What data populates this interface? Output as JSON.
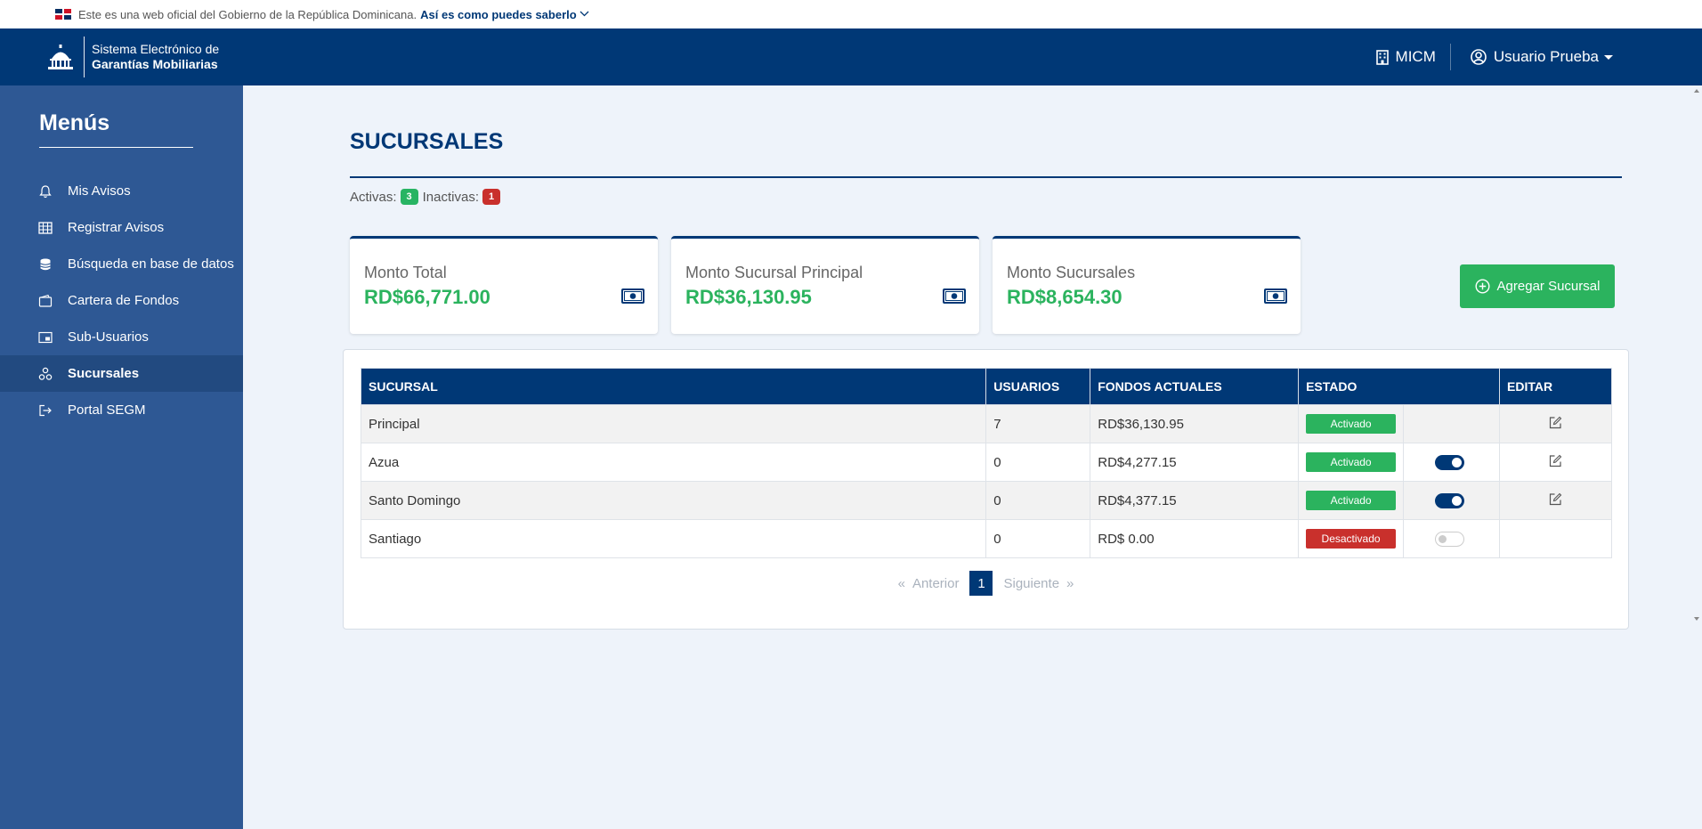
{
  "gov_banner": {
    "text": "Este es una web oficial del Gobierno de la República Dominicana.",
    "link": "Así es como puedes saberlo"
  },
  "header": {
    "brand_line1": "Sistema Electrónico de",
    "brand_line2": "Garantías Mobiliarias",
    "org": "MICM",
    "user": "Usuario Prueba"
  },
  "sidebar": {
    "title": "Menús",
    "items": [
      {
        "label": "Mis Avisos",
        "icon": "bell-icon"
      },
      {
        "label": "Registrar Avisos",
        "icon": "table-grid-icon"
      },
      {
        "label": "Búsqueda en base de datos",
        "icon": "database-icon"
      },
      {
        "label": "Cartera de Fondos",
        "icon": "wallet-icon"
      },
      {
        "label": "Sub-Usuarios",
        "icon": "user-card-icon"
      },
      {
        "label": "Sucursales",
        "icon": "branches-icon",
        "active": true
      },
      {
        "label": "Portal SEGM",
        "icon": "sign-out-icon"
      }
    ]
  },
  "page": {
    "title": "SUCURSALES",
    "active_label": "Activas:",
    "active_count": "3",
    "inactive_label": "Inactivas:",
    "inactive_count": "1"
  },
  "cards": [
    {
      "label": "Monto Total",
      "value": "RD$66,771.00",
      "icon": "money-bill-icon"
    },
    {
      "label": "Monto Sucursal Principal",
      "value": "RD$36,130.95",
      "icon": "money-bill-icon"
    },
    {
      "label": "Monto Sucursales",
      "value": "RD$8,654.30",
      "icon": "money-bill-icon"
    }
  ],
  "add_button": "Agregar Sucursal",
  "table": {
    "headers": [
      "SUCURSAL",
      "USUARIOS",
      "FONDOS ACTUALES",
      "ESTADO",
      "EDITAR"
    ],
    "rows": [
      {
        "name": "Principal",
        "users": "7",
        "funds": "RD$36,130.95",
        "status": "Activado",
        "active": true,
        "toggle": null,
        "editable": true
      },
      {
        "name": "Azua",
        "users": "0",
        "funds": "RD$4,277.15",
        "status": "Activado",
        "active": true,
        "toggle": true,
        "editable": true
      },
      {
        "name": "Santo Domingo",
        "users": "0",
        "funds": "RD$4,377.15",
        "status": "Activado",
        "active": true,
        "toggle": true,
        "editable": true
      },
      {
        "name": "Santiago",
        "users": "0",
        "funds": "RD$ 0.00",
        "status": "Desactivado",
        "active": false,
        "toggle": false,
        "editable": false
      }
    ]
  },
  "pagination": {
    "prev_symbol": "«",
    "prev": "Anterior",
    "current": "1",
    "next": "Siguiente",
    "next_symbol": "»"
  },
  "colors": {
    "primary": "#003876",
    "sidebar": "#2e5894",
    "success": "#2bb35e",
    "danger": "#c9302c"
  }
}
